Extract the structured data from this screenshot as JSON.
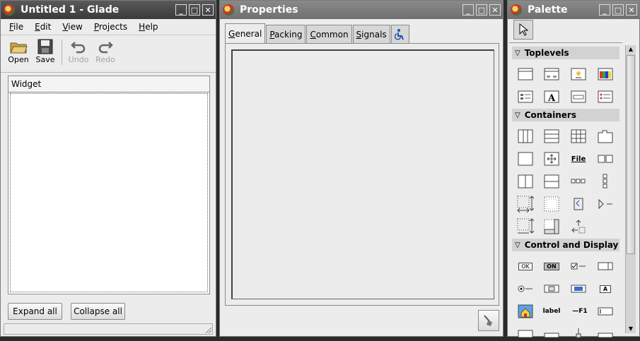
{
  "glade": {
    "title": "Untitled 1 - Glade",
    "menu": [
      "File",
      "Edit",
      "View",
      "Projects",
      "Help"
    ],
    "menu_mnemonic": [
      "F",
      "E",
      "V",
      "P",
      "H"
    ],
    "toolbar": {
      "open": "Open",
      "save": "Save",
      "undo": "Undo",
      "redo": "Redo"
    },
    "tree_header": "Widget",
    "expand_all": "Expand all",
    "collapse_all": "Collapse all"
  },
  "properties": {
    "title": "Properties",
    "tabs": [
      "General",
      "Packing",
      "Common",
      "Signals"
    ]
  },
  "palette": {
    "title": "Palette",
    "sections": [
      "Toplevels",
      "Containers",
      "Control and Display"
    ],
    "label_icon_text": "label",
    "file_icon_text": "File",
    "ok_icon_text": "OK",
    "on_icon_text": "ON",
    "f1_icon_text": "F1",
    "a_icon_text": "A"
  },
  "colors": {
    "titlebar_active": "#3a3a3a",
    "titlebar_inactive": "#7a7a7a",
    "window_bg": "#ececec"
  }
}
